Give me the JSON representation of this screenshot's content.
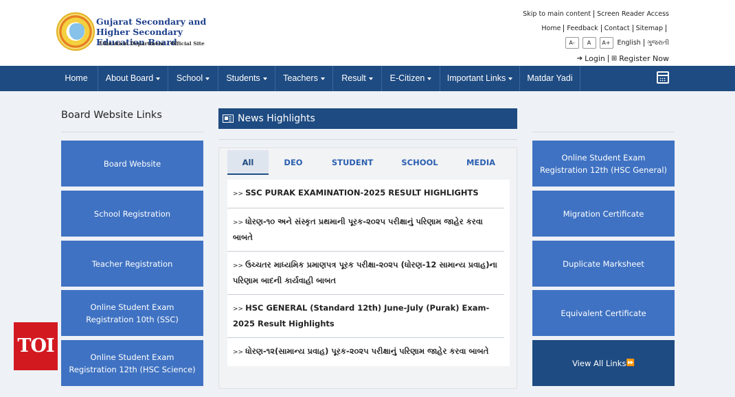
{
  "header": {
    "logo_title": "Gujarat Secondary and Higher Secondary Education Board",
    "logo_subtitle": "Education Department - Official Site",
    "toplinks": {
      "skip": "Skip to main content",
      "screen_reader": "Screen Reader Access",
      "home": "Home",
      "feedback": "Feedback",
      "contact": "Contact",
      "sitemap": "Sitemap",
      "font_minus": "A-",
      "font_normal": "A",
      "font_plus": "A+",
      "lang_en": "English",
      "lang_gu": "ગુજરાતી",
      "login": "Login",
      "register": "Register Now"
    }
  },
  "nav": {
    "items": [
      {
        "label": "Home",
        "dropdown": false
      },
      {
        "label": "About Board",
        "dropdown": true
      },
      {
        "label": "School",
        "dropdown": true
      },
      {
        "label": "Students",
        "dropdown": true
      },
      {
        "label": "Teachers",
        "dropdown": true
      },
      {
        "label": "Result",
        "dropdown": true
      },
      {
        "label": "E-Citizen",
        "dropdown": true
      },
      {
        "label": "Important Links",
        "dropdown": true
      },
      {
        "label": "Matdar Yadi",
        "dropdown": false
      }
    ],
    "calendar_icon": "calendar-icon"
  },
  "left": {
    "title": "Board Website Links",
    "tiles": [
      "Board Website",
      "School Registration",
      "Teacher Registration",
      "Online Student Exam Registration 10th (SSC)",
      "Online Student Exam Registration 12th (HSC Science)"
    ]
  },
  "news": {
    "title": "News Highlights",
    "tabs": [
      "All",
      "DEO",
      "STUDENT",
      "SCHOOL",
      "MEDIA"
    ],
    "active_tab": "All",
    "arrow": ">>",
    "items": [
      "SSC PURAK EXAMINATION-2025 RESULT HIGHLIGHTS",
      "ધોરણ-૧૦ અને સંસ્કૃત પ્રથમાની પૂરક-૨૦૨૫ પરીક્ષાનું પરિણામ જાહેર કરવા બાબતે",
      "ઉચ્ચતર માધ્યમિક પ્રમાણપત્ર પૂરક પરીક્ષા-૨૦૨૫ (ધોરણ-12 સામાન્ય પ્રવાહ)ના પરિણામ બાદની કાર્યવાહી બાબત",
      "HSC GENERAL (Standard 12th) June-July (Purak) Exam-2025 Result Highlights",
      "ધોરણ-૧૨(સામાન્ય પ્રવાહ) પૂરક-૨૦૨૫ પરીક્ષાનું પરિણામ જાહેર કરવા બાબતે"
    ]
  },
  "right": {
    "tiles": [
      "Online Student Exam Registration 12th (HSC General)",
      "Migration Certificate",
      "Duplicate Marksheet",
      "Equivalent Certificate"
    ],
    "view_all": "View All Links"
  },
  "badge": {
    "text": "TOI"
  },
  "colors": {
    "navy": "#1e4b82",
    "tile_blue": "#3f72c2",
    "badge_red": "#d31920"
  }
}
